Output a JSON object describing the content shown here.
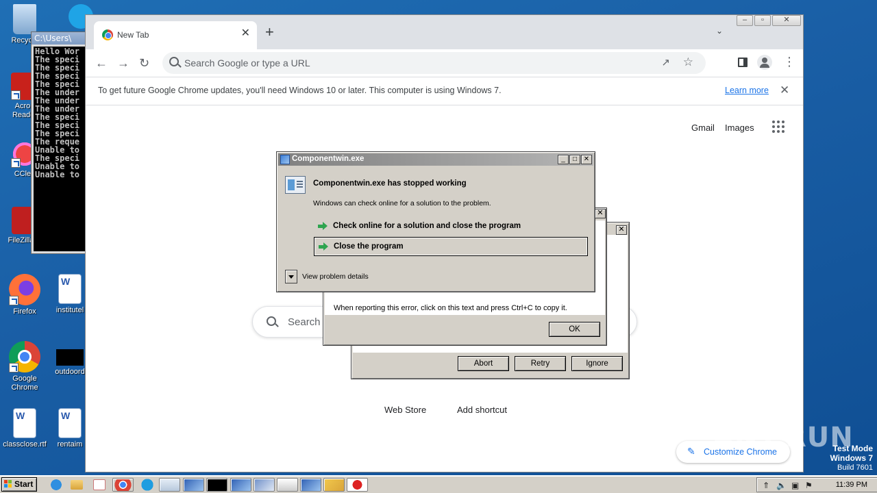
{
  "desktop": {
    "icons": [
      {
        "label": "Recycle",
        "icon": "recycle-bin-icon"
      },
      {
        "label": "Acrob Reader",
        "icon": "acrobat-reader-icon"
      },
      {
        "label": "CClea",
        "icon": "ccleaner-icon"
      },
      {
        "label": "FileZilla C",
        "icon": "filezilla-icon"
      },
      {
        "label": "Firefox",
        "icon": "firefox-icon"
      },
      {
        "label": "institutel",
        "icon": "word-document-icon"
      },
      {
        "label": "Google Chrome",
        "icon": "chrome-icon"
      },
      {
        "label": "outdoord",
        "icon": "black-file-icon"
      },
      {
        "label": "classclose.rtf",
        "icon": "word-document-icon"
      },
      {
        "label": "rentaim",
        "icon": "word-document-icon"
      }
    ],
    "watermark": "ANY.RUN",
    "test_mode": {
      "line1": "Test Mode",
      "line2": "Windows 7",
      "line3": "Build 7601"
    }
  },
  "console": {
    "title": "C:\\Users\\",
    "lines": [
      "Hello Wor",
      "The speci",
      "The speci",
      "The speci",
      "The speci",
      "The under",
      "The under",
      "The under",
      "The speci",
      "The speci",
      "The speci",
      "The reque",
      "Unable to",
      "The speci",
      "Unable to",
      "Unable to"
    ]
  },
  "chrome": {
    "tab_title": "New Tab",
    "tab_close": "✕",
    "new_tab": "+",
    "tab_search": "⌄",
    "window_buttons": {
      "minimize": "–",
      "restore": "▫",
      "close": "✕"
    },
    "omnibox_placeholder": "Search Google or type a URL",
    "infobar": {
      "text": "To get future Google Chrome updates, you'll need Windows 10 or later. This computer is using Windows 7.",
      "link": "Learn more",
      "close": "✕"
    },
    "ntp": {
      "gmail": "Gmail",
      "images": "Images",
      "search_placeholder": "Search",
      "shortcuts": [
        "Web Store",
        "Add shortcut"
      ],
      "customize": "Customize Chrome"
    }
  },
  "dialogs": {
    "main": {
      "title": "Componentwin.exe",
      "heading": "Componentwin.exe has stopped working",
      "subtext": "Windows can check online for a solution to the problem.",
      "option_check": "Check online for a solution and close the program",
      "option_close": "Close the program",
      "details": "View problem details",
      "title_buttons": {
        "minimize": "_",
        "maximize": "□",
        "close": "✕"
      }
    },
    "ok_dialog": {
      "hint": "When reporting this error, click on this text and press Ctrl+C to copy it.",
      "ok": "OK",
      "close": "✕"
    },
    "abort_dialog": {
      "abort": "Abort",
      "retry": "Retry",
      "ignore": "Ignore",
      "close": "✕"
    }
  },
  "taskbar": {
    "start": "Start",
    "clock": "11:39 PM"
  }
}
